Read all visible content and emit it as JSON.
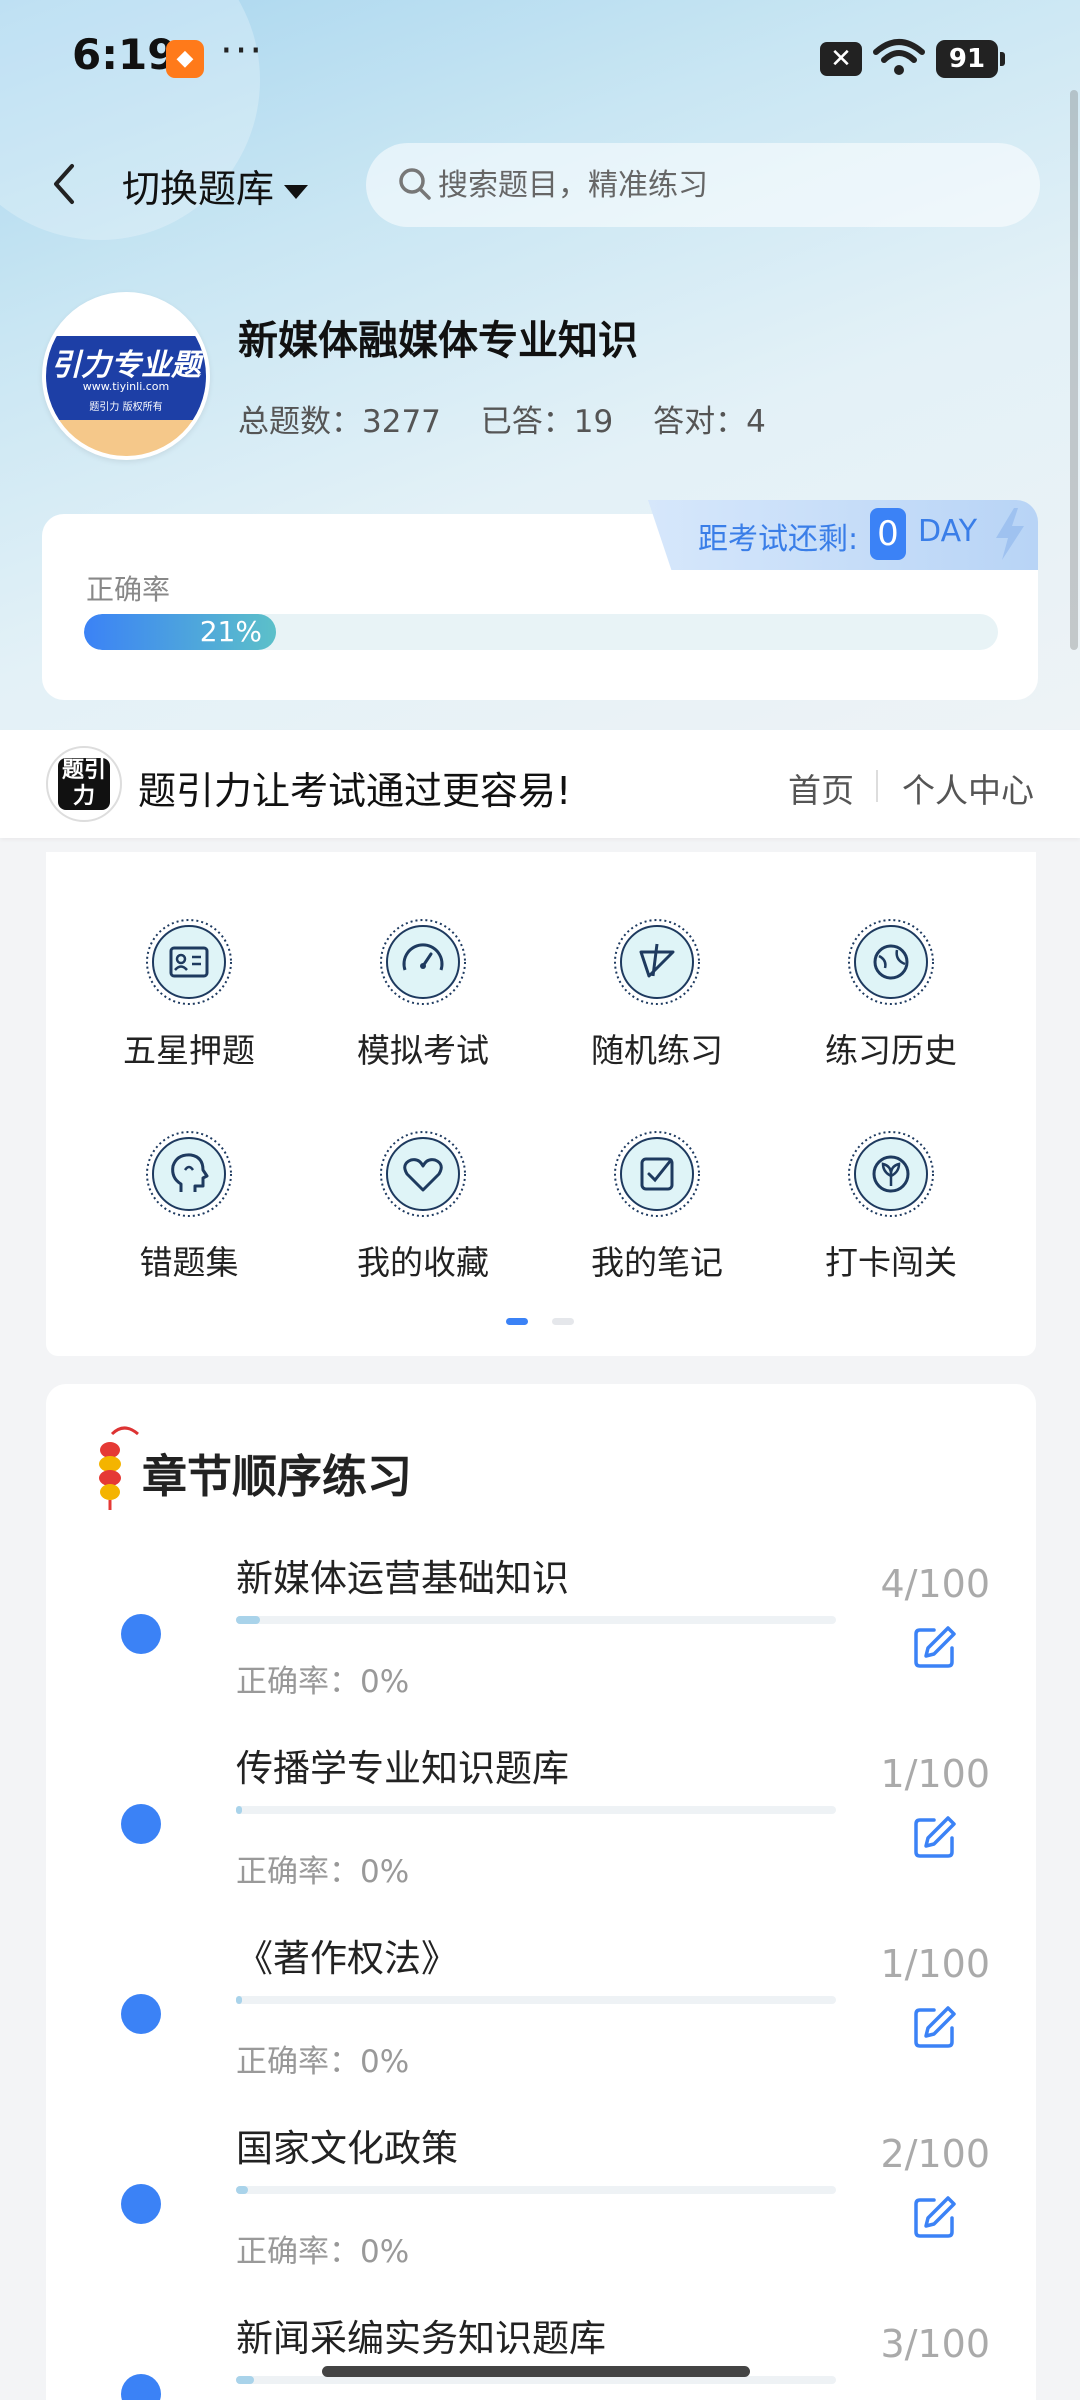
{
  "status_bar": {
    "time": "6:19",
    "more": "···",
    "battery": "91"
  },
  "top_bar": {
    "bank_switch_label": "切换题库",
    "search_placeholder": "搜索题目，精准练习"
  },
  "bank": {
    "logo_text": "引力专业题",
    "logo_url": "www.tiyinli.com",
    "logo_sub": "题引力 版权所有",
    "title": "新媒体融媒体专业知识",
    "total_label": "总题数：3277",
    "answered_label": "已答：19",
    "correct_label": "答对：4"
  },
  "accuracy": {
    "label": "正确率",
    "value": 0.21,
    "value_text": "21%",
    "countdown_label": "距考试还剩:",
    "countdown_days": "0",
    "countdown_unit": "DAY"
  },
  "brand": {
    "logo_text": "题引力",
    "slogan": "题引力让考试通过更容易!",
    "home": "首页",
    "personal": "个人中心"
  },
  "features": [
    {
      "label": "五星押题",
      "icon": "id-card-icon"
    },
    {
      "label": "模拟考试",
      "icon": "speedometer-icon"
    },
    {
      "label": "随机练习",
      "icon": "shuffle-icon"
    },
    {
      "label": "练习历史",
      "icon": "globe-icon"
    },
    {
      "label": "错题集",
      "icon": "head-icon"
    },
    {
      "label": "我的收藏",
      "icon": "heart-icon"
    },
    {
      "label": "我的笔记",
      "icon": "note-check-icon"
    },
    {
      "label": "打卡闯关",
      "icon": "leaf-badge-icon"
    }
  ],
  "pager": {
    "pages": 2,
    "active": 0
  },
  "chapters_title": "章节顺序练习",
  "chapters": [
    {
      "name": "新媒体运营基础知识",
      "accuracy": "正确率：0%",
      "count": "4/100",
      "progress": 0.04
    },
    {
      "name": "传播学专业知识题库",
      "accuracy": "正确率：0%",
      "count": "1/100",
      "progress": 0.01
    },
    {
      "name": "《著作权法》",
      "accuracy": "正确率：0%",
      "count": "1/100",
      "progress": 0.01
    },
    {
      "name": "国家文化政策",
      "accuracy": "正确率：0%",
      "count": "2/100",
      "progress": 0.02
    },
    {
      "name": "新闻采编实务知识题库",
      "accuracy": "",
      "count": "3/100",
      "progress": 0.03
    }
  ],
  "colors": {
    "accent": "#3b82f6",
    "accent_teal": "#5cc0c9",
    "icon_stroke": "#1e3a5f"
  }
}
